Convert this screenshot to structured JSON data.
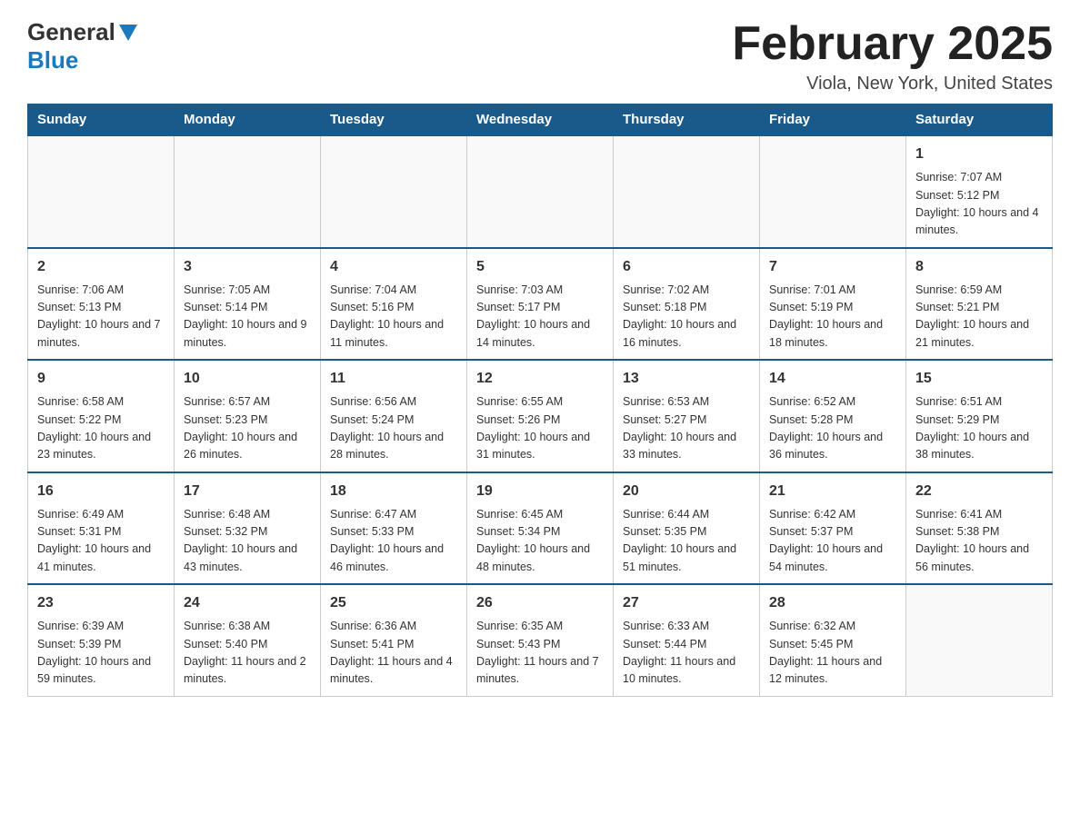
{
  "header": {
    "logo_general": "General",
    "logo_blue": "Blue",
    "month_title": "February 2025",
    "subtitle": "Viola, New York, United States"
  },
  "days_of_week": [
    "Sunday",
    "Monday",
    "Tuesday",
    "Wednesday",
    "Thursday",
    "Friday",
    "Saturday"
  ],
  "weeks": [
    [
      {
        "day": "",
        "info": ""
      },
      {
        "day": "",
        "info": ""
      },
      {
        "day": "",
        "info": ""
      },
      {
        "day": "",
        "info": ""
      },
      {
        "day": "",
        "info": ""
      },
      {
        "day": "",
        "info": ""
      },
      {
        "day": "1",
        "info": "Sunrise: 7:07 AM\nSunset: 5:12 PM\nDaylight: 10 hours and 4 minutes."
      }
    ],
    [
      {
        "day": "2",
        "info": "Sunrise: 7:06 AM\nSunset: 5:13 PM\nDaylight: 10 hours and 7 minutes."
      },
      {
        "day": "3",
        "info": "Sunrise: 7:05 AM\nSunset: 5:14 PM\nDaylight: 10 hours and 9 minutes."
      },
      {
        "day": "4",
        "info": "Sunrise: 7:04 AM\nSunset: 5:16 PM\nDaylight: 10 hours and 11 minutes."
      },
      {
        "day": "5",
        "info": "Sunrise: 7:03 AM\nSunset: 5:17 PM\nDaylight: 10 hours and 14 minutes."
      },
      {
        "day": "6",
        "info": "Sunrise: 7:02 AM\nSunset: 5:18 PM\nDaylight: 10 hours and 16 minutes."
      },
      {
        "day": "7",
        "info": "Sunrise: 7:01 AM\nSunset: 5:19 PM\nDaylight: 10 hours and 18 minutes."
      },
      {
        "day": "8",
        "info": "Sunrise: 6:59 AM\nSunset: 5:21 PM\nDaylight: 10 hours and 21 minutes."
      }
    ],
    [
      {
        "day": "9",
        "info": "Sunrise: 6:58 AM\nSunset: 5:22 PM\nDaylight: 10 hours and 23 minutes."
      },
      {
        "day": "10",
        "info": "Sunrise: 6:57 AM\nSunset: 5:23 PM\nDaylight: 10 hours and 26 minutes."
      },
      {
        "day": "11",
        "info": "Sunrise: 6:56 AM\nSunset: 5:24 PM\nDaylight: 10 hours and 28 minutes."
      },
      {
        "day": "12",
        "info": "Sunrise: 6:55 AM\nSunset: 5:26 PM\nDaylight: 10 hours and 31 minutes."
      },
      {
        "day": "13",
        "info": "Sunrise: 6:53 AM\nSunset: 5:27 PM\nDaylight: 10 hours and 33 minutes."
      },
      {
        "day": "14",
        "info": "Sunrise: 6:52 AM\nSunset: 5:28 PM\nDaylight: 10 hours and 36 minutes."
      },
      {
        "day": "15",
        "info": "Sunrise: 6:51 AM\nSunset: 5:29 PM\nDaylight: 10 hours and 38 minutes."
      }
    ],
    [
      {
        "day": "16",
        "info": "Sunrise: 6:49 AM\nSunset: 5:31 PM\nDaylight: 10 hours and 41 minutes."
      },
      {
        "day": "17",
        "info": "Sunrise: 6:48 AM\nSunset: 5:32 PM\nDaylight: 10 hours and 43 minutes."
      },
      {
        "day": "18",
        "info": "Sunrise: 6:47 AM\nSunset: 5:33 PM\nDaylight: 10 hours and 46 minutes."
      },
      {
        "day": "19",
        "info": "Sunrise: 6:45 AM\nSunset: 5:34 PM\nDaylight: 10 hours and 48 minutes."
      },
      {
        "day": "20",
        "info": "Sunrise: 6:44 AM\nSunset: 5:35 PM\nDaylight: 10 hours and 51 minutes."
      },
      {
        "day": "21",
        "info": "Sunrise: 6:42 AM\nSunset: 5:37 PM\nDaylight: 10 hours and 54 minutes."
      },
      {
        "day": "22",
        "info": "Sunrise: 6:41 AM\nSunset: 5:38 PM\nDaylight: 10 hours and 56 minutes."
      }
    ],
    [
      {
        "day": "23",
        "info": "Sunrise: 6:39 AM\nSunset: 5:39 PM\nDaylight: 10 hours and 59 minutes."
      },
      {
        "day": "24",
        "info": "Sunrise: 6:38 AM\nSunset: 5:40 PM\nDaylight: 11 hours and 2 minutes."
      },
      {
        "day": "25",
        "info": "Sunrise: 6:36 AM\nSunset: 5:41 PM\nDaylight: 11 hours and 4 minutes."
      },
      {
        "day": "26",
        "info": "Sunrise: 6:35 AM\nSunset: 5:43 PM\nDaylight: 11 hours and 7 minutes."
      },
      {
        "day": "27",
        "info": "Sunrise: 6:33 AM\nSunset: 5:44 PM\nDaylight: 11 hours and 10 minutes."
      },
      {
        "day": "28",
        "info": "Sunrise: 6:32 AM\nSunset: 5:45 PM\nDaylight: 11 hours and 12 minutes."
      },
      {
        "day": "",
        "info": ""
      }
    ]
  ]
}
